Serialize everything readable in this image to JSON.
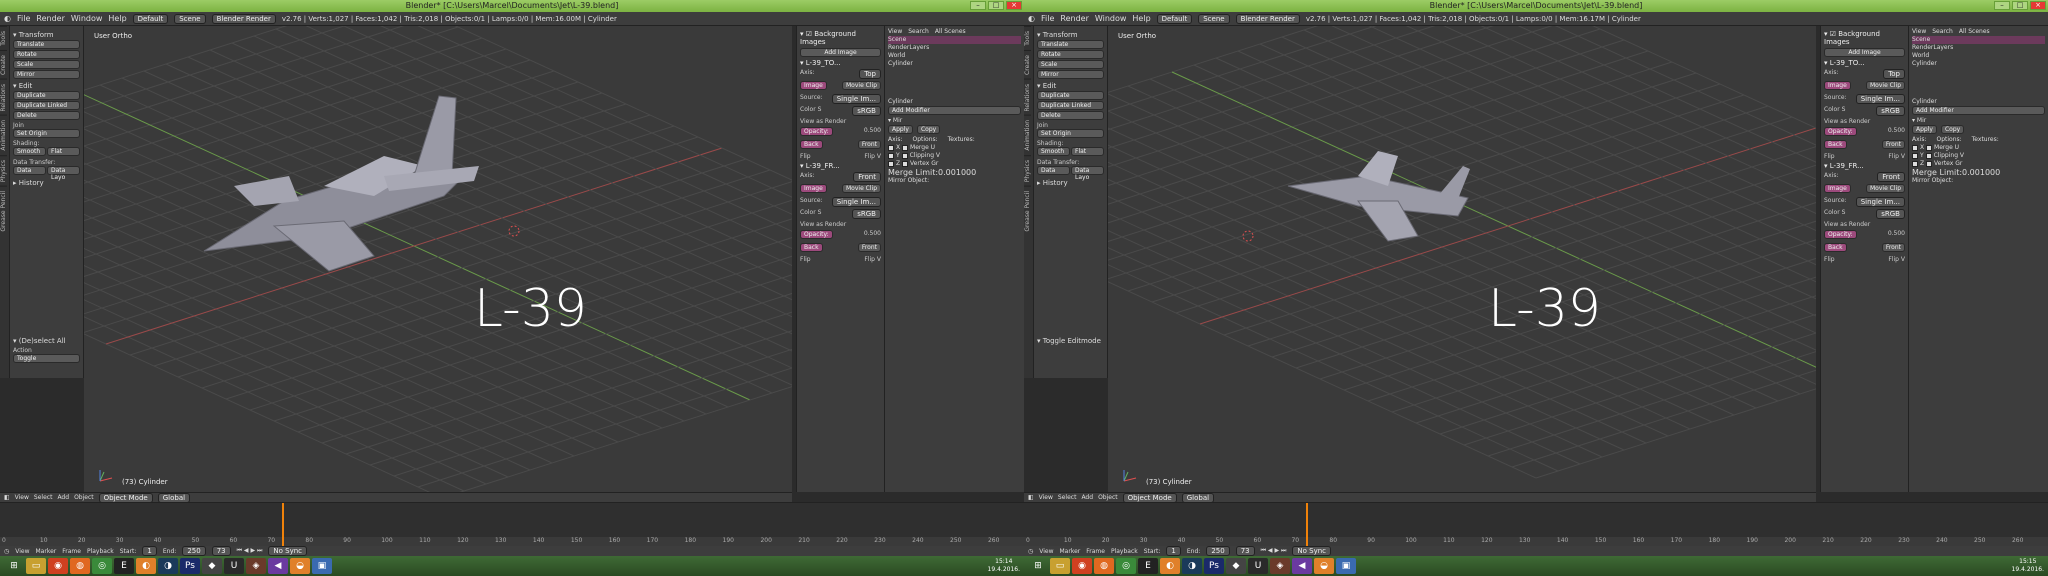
{
  "screens": [
    {
      "titlebar": "Blender* [C:\\Users\\Marcel\\Documents\\Jet\\L-39.blend]",
      "stats": "v2.76 | Verts:1,027 | Faces:1,042 | Tris:2,018 | Objects:0/1 | Lamps:0/0 | Mem:16.00M | Cylinder",
      "viewport_label": "User Ortho",
      "viewport_obj": "(73) Cylinder",
      "taskbar_time": "15:14",
      "lower_panel": "(De)select All",
      "lower_panel_action_label": "Action",
      "lower_panel_action": "Toggle"
    },
    {
      "titlebar": "Blender* [C:\\Users\\Marcel\\Documents\\Jet\\L-39.blend]",
      "stats": "v2.76 | Verts:1,027 | Faces:1,042 | Tris:2,018 | Objects:0/1 | Lamps:0/0 | Mem:16.17M | Cylinder",
      "viewport_label": "User Ortho",
      "viewport_obj": "(73) Cylinder",
      "taskbar_time": "15:15",
      "lower_panel": "Toggle Editmode",
      "lower_panel_action_label": "",
      "lower_panel_action": ""
    }
  ],
  "topbar": {
    "menus": [
      "File",
      "Render",
      "Window",
      "Help"
    ],
    "layout": "Default",
    "scene": "Scene",
    "engine": "Blender Render"
  },
  "tool_tabs": [
    "Tools",
    "Create",
    "Relations",
    "Animation",
    "Physics",
    "Grease Pencil"
  ],
  "toolshelf": {
    "transform": "Transform",
    "transform_btns": [
      "Translate",
      "Rotate",
      "Scale",
      "Mirror"
    ],
    "edit": "Edit",
    "edit_btns": [
      "Duplicate",
      "Duplicate Linked",
      "Delete"
    ],
    "join": "Join",
    "set_origin": "Set Origin",
    "shading": "Shading:",
    "smooth": "Smooth",
    "flat": "Flat",
    "data_transfer": "Data Transfer:",
    "data": "Data",
    "data_layout": "Data Layo",
    "history": "History"
  },
  "props": {
    "bg_images": "Background Images",
    "add_image": "Add Image",
    "img1_name": "L-39_TO...",
    "img1_axis": "Top",
    "img2_name": "L-39_FR...",
    "img2_axis": "Front",
    "axis_label": "Axis:",
    "image": "Image",
    "movie_clip": "Movie Clip",
    "source_label": "Source:",
    "source": "Single Im...",
    "color_label": "Color S",
    "color": "sRGB",
    "view_as_render": "View as Render",
    "opacity_label": "Opacity:",
    "opacity": "0.500",
    "back": "Back",
    "front": "Front",
    "flip_x": "Flip",
    "flip_y": "Flip V"
  },
  "outliner": {
    "menus": [
      "View",
      "Search",
      "All Scenes"
    ],
    "items": [
      "Scene",
      "RenderLayers",
      "World",
      "Cylinder"
    ],
    "object": "Cylinder",
    "add_modifier": "Add Modifier",
    "mod_name": "Mir",
    "apply": "Apply",
    "copy": "Copy",
    "axis": "Axis:",
    "options": "Options:",
    "textures": "Textures:",
    "x": "X",
    "y": "Y",
    "z": "Z",
    "merge": "Merge",
    "clipping": "Clipping",
    "vertex_gr": "Vertex Gr",
    "u": "U",
    "v": "V",
    "merge_limit_label": "Merge Limit:",
    "merge_limit": "0.001000",
    "mirror_object": "Mirror Object:"
  },
  "header3d": {
    "menus": [
      "View",
      "Select",
      "Add",
      "Object"
    ],
    "mode": "Object Mode",
    "pivot": "Global"
  },
  "timeline": {
    "menus": [
      "View",
      "Marker",
      "Frame",
      "Playback"
    ],
    "start_label": "Start:",
    "start": "1",
    "end_label": "End:",
    "end": "250",
    "current": "73",
    "sync": "No Sync",
    "ruler": [
      "0",
      "10",
      "20",
      "30",
      "40",
      "50",
      "60",
      "70",
      "80",
      "90",
      "100",
      "110",
      "120",
      "130",
      "140",
      "150",
      "160",
      "170",
      "180",
      "190",
      "200",
      "210",
      "220",
      "230",
      "240",
      "250",
      "260"
    ],
    "playhead_frame": 73
  },
  "watermark": "L-39",
  "taskbar_date": "19.4.2016.",
  "taskbar_icons": [
    "folder-icon",
    "pdf-icon",
    "firefox-icon",
    "chrome-icon",
    "epic-icon",
    "blender-icon",
    "steam-icon",
    "photoshop-icon",
    "unity-icon",
    "ue-icon",
    "game-icon",
    "vs-icon",
    "blender-run-icon",
    "app-icon"
  ],
  "taskbar_glyphs": [
    "▭",
    "◉",
    "◍",
    "◎",
    "E",
    "◐",
    "◑",
    "Ps",
    "◆",
    "U",
    "◈",
    "◀",
    "◒",
    "▣"
  ]
}
